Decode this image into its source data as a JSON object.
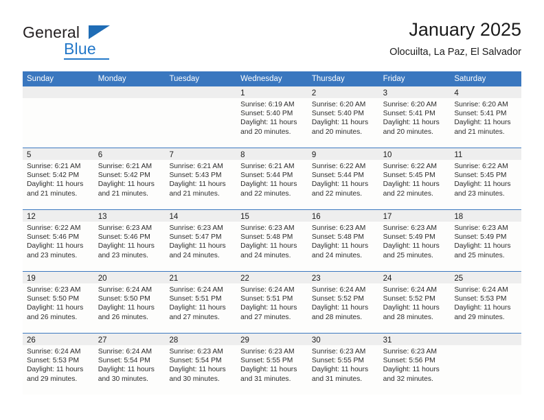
{
  "brand": {
    "name_part1": "General",
    "name_part2": "Blue",
    "logo_icon": "blue-triangle-logo",
    "accent_color": "#2277c8"
  },
  "header": {
    "title": "January 2025",
    "subtitle": "Olocuilta, La Paz, El Salvador"
  },
  "colors": {
    "header_band": "#3a77bf",
    "daynum_strip": "#eeeeee",
    "cell_body": "#fdfdfc",
    "text": "#1a1a1a"
  },
  "calendar": {
    "day_headers": [
      "Sunday",
      "Monday",
      "Tuesday",
      "Wednesday",
      "Thursday",
      "Friday",
      "Saturday"
    ],
    "weeks": [
      [
        {
          "day": "",
          "lines": []
        },
        {
          "day": "",
          "lines": []
        },
        {
          "day": "",
          "lines": []
        },
        {
          "day": "1",
          "lines": [
            "Sunrise: 6:19 AM",
            "Sunset: 5:40 PM",
            "Daylight: 11 hours",
            "and 20 minutes."
          ]
        },
        {
          "day": "2",
          "lines": [
            "Sunrise: 6:20 AM",
            "Sunset: 5:40 PM",
            "Daylight: 11 hours",
            "and 20 minutes."
          ]
        },
        {
          "day": "3",
          "lines": [
            "Sunrise: 6:20 AM",
            "Sunset: 5:41 PM",
            "Daylight: 11 hours",
            "and 20 minutes."
          ]
        },
        {
          "day": "4",
          "lines": [
            "Sunrise: 6:20 AM",
            "Sunset: 5:41 PM",
            "Daylight: 11 hours",
            "and 21 minutes."
          ]
        }
      ],
      [
        {
          "day": "5",
          "lines": [
            "Sunrise: 6:21 AM",
            "Sunset: 5:42 PM",
            "Daylight: 11 hours",
            "and 21 minutes."
          ]
        },
        {
          "day": "6",
          "lines": [
            "Sunrise: 6:21 AM",
            "Sunset: 5:42 PM",
            "Daylight: 11 hours",
            "and 21 minutes."
          ]
        },
        {
          "day": "7",
          "lines": [
            "Sunrise: 6:21 AM",
            "Sunset: 5:43 PM",
            "Daylight: 11 hours",
            "and 21 minutes."
          ]
        },
        {
          "day": "8",
          "lines": [
            "Sunrise: 6:21 AM",
            "Sunset: 5:44 PM",
            "Daylight: 11 hours",
            "and 22 minutes."
          ]
        },
        {
          "day": "9",
          "lines": [
            "Sunrise: 6:22 AM",
            "Sunset: 5:44 PM",
            "Daylight: 11 hours",
            "and 22 minutes."
          ]
        },
        {
          "day": "10",
          "lines": [
            "Sunrise: 6:22 AM",
            "Sunset: 5:45 PM",
            "Daylight: 11 hours",
            "and 22 minutes."
          ]
        },
        {
          "day": "11",
          "lines": [
            "Sunrise: 6:22 AM",
            "Sunset: 5:45 PM",
            "Daylight: 11 hours",
            "and 23 minutes."
          ]
        }
      ],
      [
        {
          "day": "12",
          "lines": [
            "Sunrise: 6:22 AM",
            "Sunset: 5:46 PM",
            "Daylight: 11 hours",
            "and 23 minutes."
          ]
        },
        {
          "day": "13",
          "lines": [
            "Sunrise: 6:23 AM",
            "Sunset: 5:46 PM",
            "Daylight: 11 hours",
            "and 23 minutes."
          ]
        },
        {
          "day": "14",
          "lines": [
            "Sunrise: 6:23 AM",
            "Sunset: 5:47 PM",
            "Daylight: 11 hours",
            "and 24 minutes."
          ]
        },
        {
          "day": "15",
          "lines": [
            "Sunrise: 6:23 AM",
            "Sunset: 5:48 PM",
            "Daylight: 11 hours",
            "and 24 minutes."
          ]
        },
        {
          "day": "16",
          "lines": [
            "Sunrise: 6:23 AM",
            "Sunset: 5:48 PM",
            "Daylight: 11 hours",
            "and 24 minutes."
          ]
        },
        {
          "day": "17",
          "lines": [
            "Sunrise: 6:23 AM",
            "Sunset: 5:49 PM",
            "Daylight: 11 hours",
            "and 25 minutes."
          ]
        },
        {
          "day": "18",
          "lines": [
            "Sunrise: 6:23 AM",
            "Sunset: 5:49 PM",
            "Daylight: 11 hours",
            "and 25 minutes."
          ]
        }
      ],
      [
        {
          "day": "19",
          "lines": [
            "Sunrise: 6:23 AM",
            "Sunset: 5:50 PM",
            "Daylight: 11 hours",
            "and 26 minutes."
          ]
        },
        {
          "day": "20",
          "lines": [
            "Sunrise: 6:24 AM",
            "Sunset: 5:50 PM",
            "Daylight: 11 hours",
            "and 26 minutes."
          ]
        },
        {
          "day": "21",
          "lines": [
            "Sunrise: 6:24 AM",
            "Sunset: 5:51 PM",
            "Daylight: 11 hours",
            "and 27 minutes."
          ]
        },
        {
          "day": "22",
          "lines": [
            "Sunrise: 6:24 AM",
            "Sunset: 5:51 PM",
            "Daylight: 11 hours",
            "and 27 minutes."
          ]
        },
        {
          "day": "23",
          "lines": [
            "Sunrise: 6:24 AM",
            "Sunset: 5:52 PM",
            "Daylight: 11 hours",
            "and 28 minutes."
          ]
        },
        {
          "day": "24",
          "lines": [
            "Sunrise: 6:24 AM",
            "Sunset: 5:52 PM",
            "Daylight: 11 hours",
            "and 28 minutes."
          ]
        },
        {
          "day": "25",
          "lines": [
            "Sunrise: 6:24 AM",
            "Sunset: 5:53 PM",
            "Daylight: 11 hours",
            "and 29 minutes."
          ]
        }
      ],
      [
        {
          "day": "26",
          "lines": [
            "Sunrise: 6:24 AM",
            "Sunset: 5:53 PM",
            "Daylight: 11 hours",
            "and 29 minutes."
          ]
        },
        {
          "day": "27",
          "lines": [
            "Sunrise: 6:24 AM",
            "Sunset: 5:54 PM",
            "Daylight: 11 hours",
            "and 30 minutes."
          ]
        },
        {
          "day": "28",
          "lines": [
            "Sunrise: 6:23 AM",
            "Sunset: 5:54 PM",
            "Daylight: 11 hours",
            "and 30 minutes."
          ]
        },
        {
          "day": "29",
          "lines": [
            "Sunrise: 6:23 AM",
            "Sunset: 5:55 PM",
            "Daylight: 11 hours",
            "and 31 minutes."
          ]
        },
        {
          "day": "30",
          "lines": [
            "Sunrise: 6:23 AM",
            "Sunset: 5:55 PM",
            "Daylight: 11 hours",
            "and 31 minutes."
          ]
        },
        {
          "day": "31",
          "lines": [
            "Sunrise: 6:23 AM",
            "Sunset: 5:56 PM",
            "Daylight: 11 hours",
            "and 32 minutes."
          ]
        },
        {
          "day": "",
          "lines": []
        }
      ]
    ]
  }
}
